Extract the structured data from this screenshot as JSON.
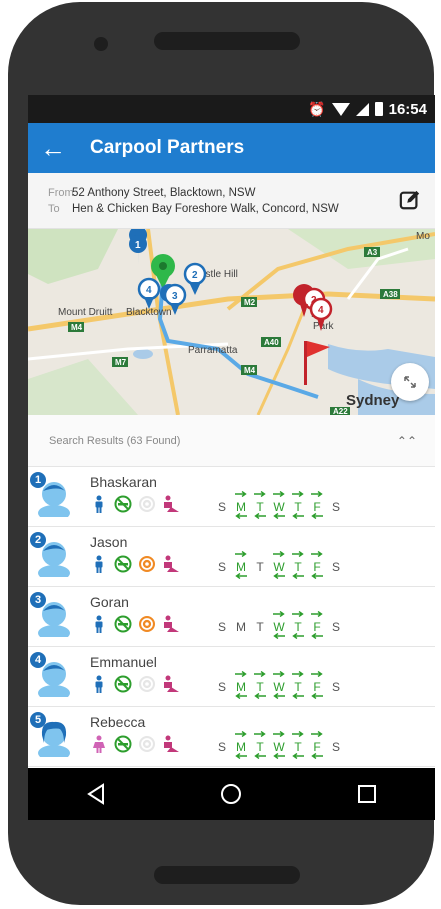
{
  "status": {
    "time": "16:54"
  },
  "appbar": {
    "title": "Carpool Partners"
  },
  "route": {
    "from_label": "From",
    "from_value": "52 Anthony Street, Blacktown, NSW",
    "to_label": "To",
    "to_value": "Hen & Chicken Bay Foreshore Walk, Concord, NSW"
  },
  "map": {
    "places": {
      "castle_hill": "astle Hill",
      "mount_druitt": "Mount Druitt",
      "blacktown": "Blacktown",
      "parramatta": "Parramatta",
      "sydney": "Sydney",
      "macquarie_park_1": "Mac",
      "macquarie_park_2": "Park",
      "mo": "Mo"
    },
    "roads": {
      "m4": "M4",
      "m7": "M7",
      "m2": "M2",
      "a40": "A40",
      "a3": "A3",
      "a38": "A38",
      "m4b": "M4",
      "a22": "A22"
    },
    "markers": [
      "1",
      "2",
      "3",
      "4",
      "2",
      "4"
    ]
  },
  "results": {
    "header": "Search Results (63 Found)",
    "collapse_icon": "chevron-up-double-icon",
    "items": [
      {
        "num": "1",
        "name": "Bhaskaran",
        "gender": "male",
        "smoke": "no",
        "drive": "no",
        "shared": "yes",
        "days": [
          "S",
          "M",
          "T",
          "W",
          "T",
          "F",
          "S"
        ],
        "active": [
          false,
          true,
          true,
          true,
          true,
          true,
          false
        ]
      },
      {
        "num": "2",
        "name": "Jason",
        "gender": "male",
        "smoke": "no",
        "drive": "yes",
        "shared": "yes",
        "days": [
          "S",
          "M",
          "T",
          "W",
          "T",
          "F",
          "S"
        ],
        "active": [
          false,
          true,
          false,
          true,
          true,
          true,
          false
        ]
      },
      {
        "num": "3",
        "name": "Goran",
        "gender": "male",
        "smoke": "no",
        "drive": "yes",
        "shared": "yes",
        "days": [
          "S",
          "M",
          "T",
          "W",
          "T",
          "F",
          "S"
        ],
        "active": [
          false,
          false,
          false,
          true,
          true,
          true,
          false
        ]
      },
      {
        "num": "4",
        "name": "Emmanuel",
        "gender": "male",
        "smoke": "no",
        "drive": "no",
        "shared": "yes",
        "days": [
          "S",
          "M",
          "T",
          "W",
          "T",
          "F",
          "S"
        ],
        "active": [
          false,
          true,
          true,
          true,
          true,
          true,
          false
        ]
      },
      {
        "num": "5",
        "name": "Rebecca",
        "gender": "female",
        "smoke": "no",
        "drive": "no",
        "shared": "yes",
        "days": [
          "S",
          "M",
          "T",
          "W",
          "T",
          "F",
          "S"
        ],
        "active": [
          false,
          true,
          true,
          true,
          true,
          true,
          false
        ]
      }
    ]
  },
  "colors": {
    "primary": "#1f7dcf",
    "green": "#2e9e2e",
    "pink": "#c2387a",
    "orange": "#f08a24",
    "marker_blue": "#1f6fb8",
    "marker_red": "#c2232b"
  }
}
